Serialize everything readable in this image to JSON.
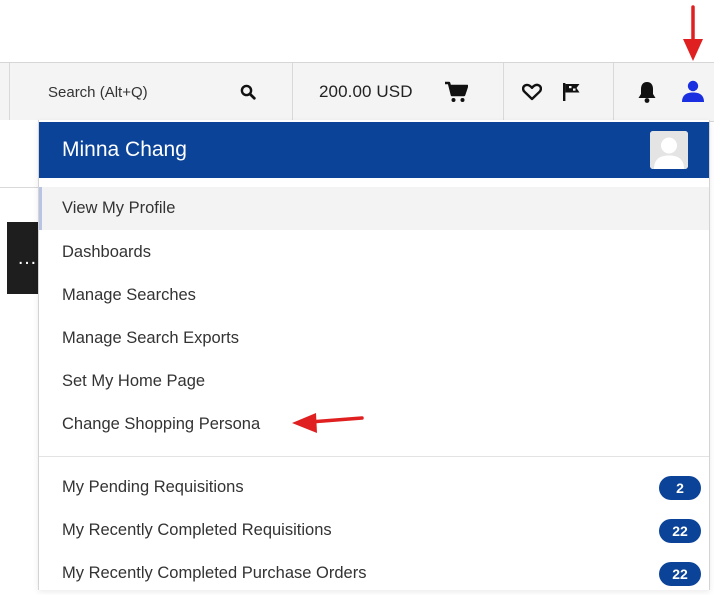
{
  "topbar": {
    "search_label": "Search (Alt+Q)",
    "search_icon": "search-icon",
    "cart_amount": "200.00 USD",
    "cart_icon": "shopping-cart-icon",
    "favorites_icon": "heart-icon",
    "flag_icon": "flag-icon",
    "notifications_icon": "bell-icon",
    "user_icon": "user-icon",
    "user_icon_color": "#1a2fe0"
  },
  "left_panel": {
    "truncated_text": "…"
  },
  "dropdown": {
    "user_name": "Minna Chang",
    "header_color": "#0b4398",
    "avatar_icon": "avatar-placeholder-icon",
    "items": [
      {
        "label": "View My Profile"
      },
      {
        "label": "Dashboards"
      },
      {
        "label": "Manage Searches"
      },
      {
        "label": "Manage Search Exports"
      },
      {
        "label": "Set My Home Page"
      },
      {
        "label": "Change Shopping Persona"
      }
    ],
    "count_items": [
      {
        "label": "My Pending Requisitions",
        "count": "2"
      },
      {
        "label": "My Recently Completed Requisitions",
        "count": "22"
      },
      {
        "label": "My Recently Completed Purchase Orders",
        "count": "22"
      }
    ]
  },
  "annotations": {
    "arrow_color": "#e02020",
    "arrows": [
      "arrow-down-icon",
      "arrow-left-icon"
    ]
  }
}
